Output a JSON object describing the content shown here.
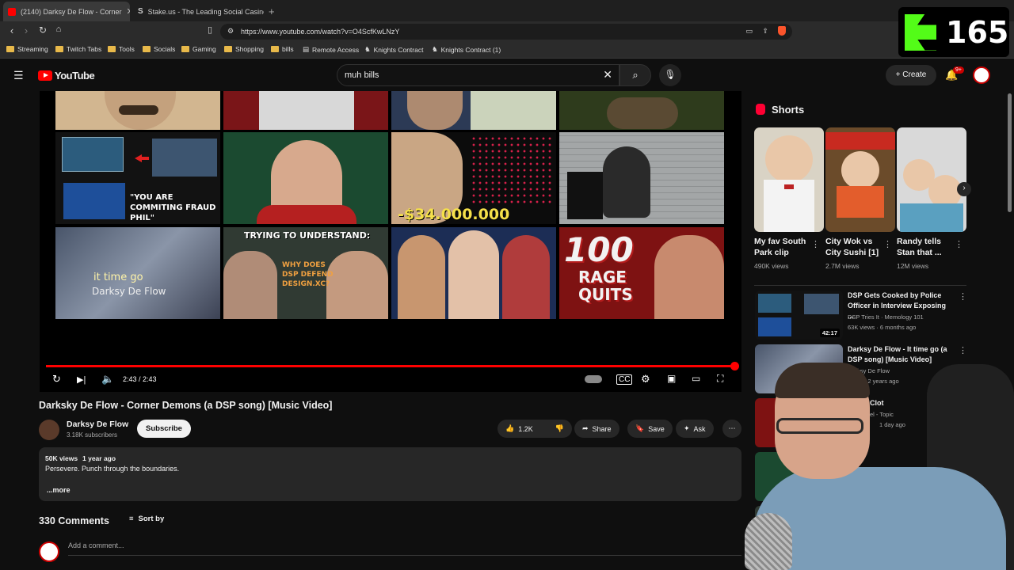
{
  "browser": {
    "tabs": [
      {
        "title": "(2140) Darksy De Flow - Corner",
        "active": true
      },
      {
        "title": "Stake.us - The Leading Social Casino",
        "active": false
      }
    ],
    "url": "https://www.youtube.com/watch?v=O4ScfKwLNzY",
    "bookmarks": [
      "Streaming",
      "Twitch Tabs",
      "Tools",
      "Socials",
      "Gaming",
      "Shopping",
      "bills",
      "Remote Access",
      "Knights Contract",
      "Knights Contract (1)"
    ]
  },
  "overlay": {
    "counter": "165",
    "accent": "#53fc18"
  },
  "youtube": {
    "logo": "YouTube",
    "search_value": "muh bills",
    "create_label": "Create",
    "notification_badge": "9+"
  },
  "player": {
    "thumb_texts": {
      "fraud": "\"YOU ARE COMMITING FRAUD PHIL\"",
      "money": "-$34.000.000",
      "trying": "TRYING TO UNDERSTAND:",
      "why": "WHY DOES DSP DEFEND DESIGN.XC?",
      "rage_num": "100",
      "rage_words": "RAGE QUITS",
      "lyric1": "it time go",
      "lyric2": "Darksy De Flow"
    },
    "time": "2:43 / 2:43",
    "progress_fraction": 1.0
  },
  "video": {
    "title": "Darksky De Flow - Corner Demons (a DSP song) [Music Video]",
    "channel": "Darksy De Flow",
    "subscribers": "3.18K subscribers",
    "subscribe_label": "Subscribe",
    "likes": "1.2K",
    "share_label": "Share",
    "save_label": "Save",
    "ask_label": "Ask",
    "views": "50K views",
    "age": "1 year ago",
    "description": "Persevere. Punch through the boundaries.",
    "more_label": "...more",
    "comments_count": "330 Comments",
    "sort_label": "Sort by",
    "add_comment": "Add a comment..."
  },
  "sidebar": {
    "shorts_title": "Shorts",
    "shorts": [
      {
        "title": "My fav South Park clip",
        "views": "490K views"
      },
      {
        "title": "City Wok vs City Sushi [1]",
        "views": "2.7M views"
      },
      {
        "title": "Randy tells Stan that ...",
        "views": "12M views"
      }
    ],
    "recommendations": [
      {
        "title": "DSP Gets Cooked by Police Officer in Interview Exposing ...",
        "channel": "DSP Tries It · Memology 101",
        "meta": "63K views · 6 months ago",
        "duration": "42:17"
      },
      {
        "title": "Darksy De Flow - It time go (a DSP song) [Music Video]",
        "channel": "Darksy De Flow",
        "meta": "views · 2 years ago",
        "duration": ""
      },
      {
        "title": "Clot",
        "channel": "el - Topic",
        "meta": "1 day ago",
        "duration": ""
      }
    ]
  }
}
